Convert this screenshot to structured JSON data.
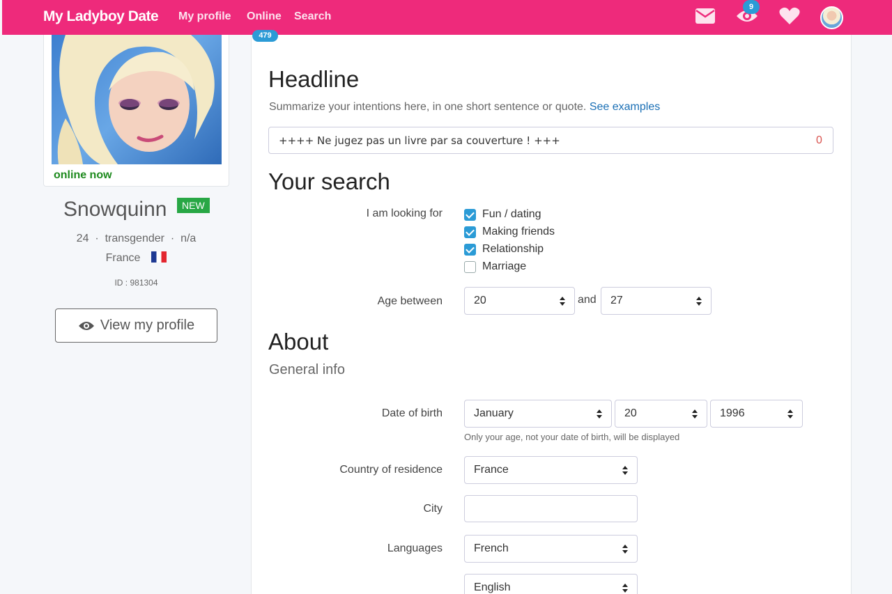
{
  "navbar": {
    "brand": "My Ladyboy Date",
    "links": {
      "my_profile": "My profile",
      "online": "Online",
      "search": "Search"
    },
    "online_count": "479",
    "views_count": "9",
    "icons": [
      "envelope-icon",
      "eye-icon",
      "heart-icon",
      "avatar"
    ],
    "accent_color": "#ee2a7b"
  },
  "sidebar": {
    "status": "online now",
    "username": "Snowquinn",
    "new_badge": "NEW",
    "stats": "24  ·  transgender  ·  n/a",
    "country": "France",
    "id_text": "ID : 981304",
    "view_profile_label": "View my profile"
  },
  "headline": {
    "title": "Headline",
    "help": "Summarize your intentions here, in one short sentence or quote.",
    "help_link": "See examples",
    "value": "++++ Ne jugez pas un livre par sa couverture ! +++",
    "char_count": "0"
  },
  "search": {
    "title": "Your search",
    "looking_for_label": "I am looking for",
    "options": [
      {
        "label": "Fun / dating",
        "checked": true
      },
      {
        "label": "Making friends",
        "checked": true
      },
      {
        "label": "Relationship",
        "checked": true
      },
      {
        "label": "Marriage",
        "checked": false
      }
    ],
    "age_label": "Age between",
    "age_min": "20",
    "and_text": "and",
    "age_max": "27"
  },
  "about": {
    "title": "About",
    "subtitle": "General info",
    "dob_label": "Date of birth",
    "dob_month": "January",
    "dob_day": "20",
    "dob_year": "1996",
    "dob_help": "Only your age, not your date of birth, will be displayed",
    "country_label": "Country of residence",
    "country_value": "France",
    "city_label": "City",
    "city_value": "",
    "languages_label": "Languages",
    "language_1": "French",
    "language_2": "English"
  }
}
